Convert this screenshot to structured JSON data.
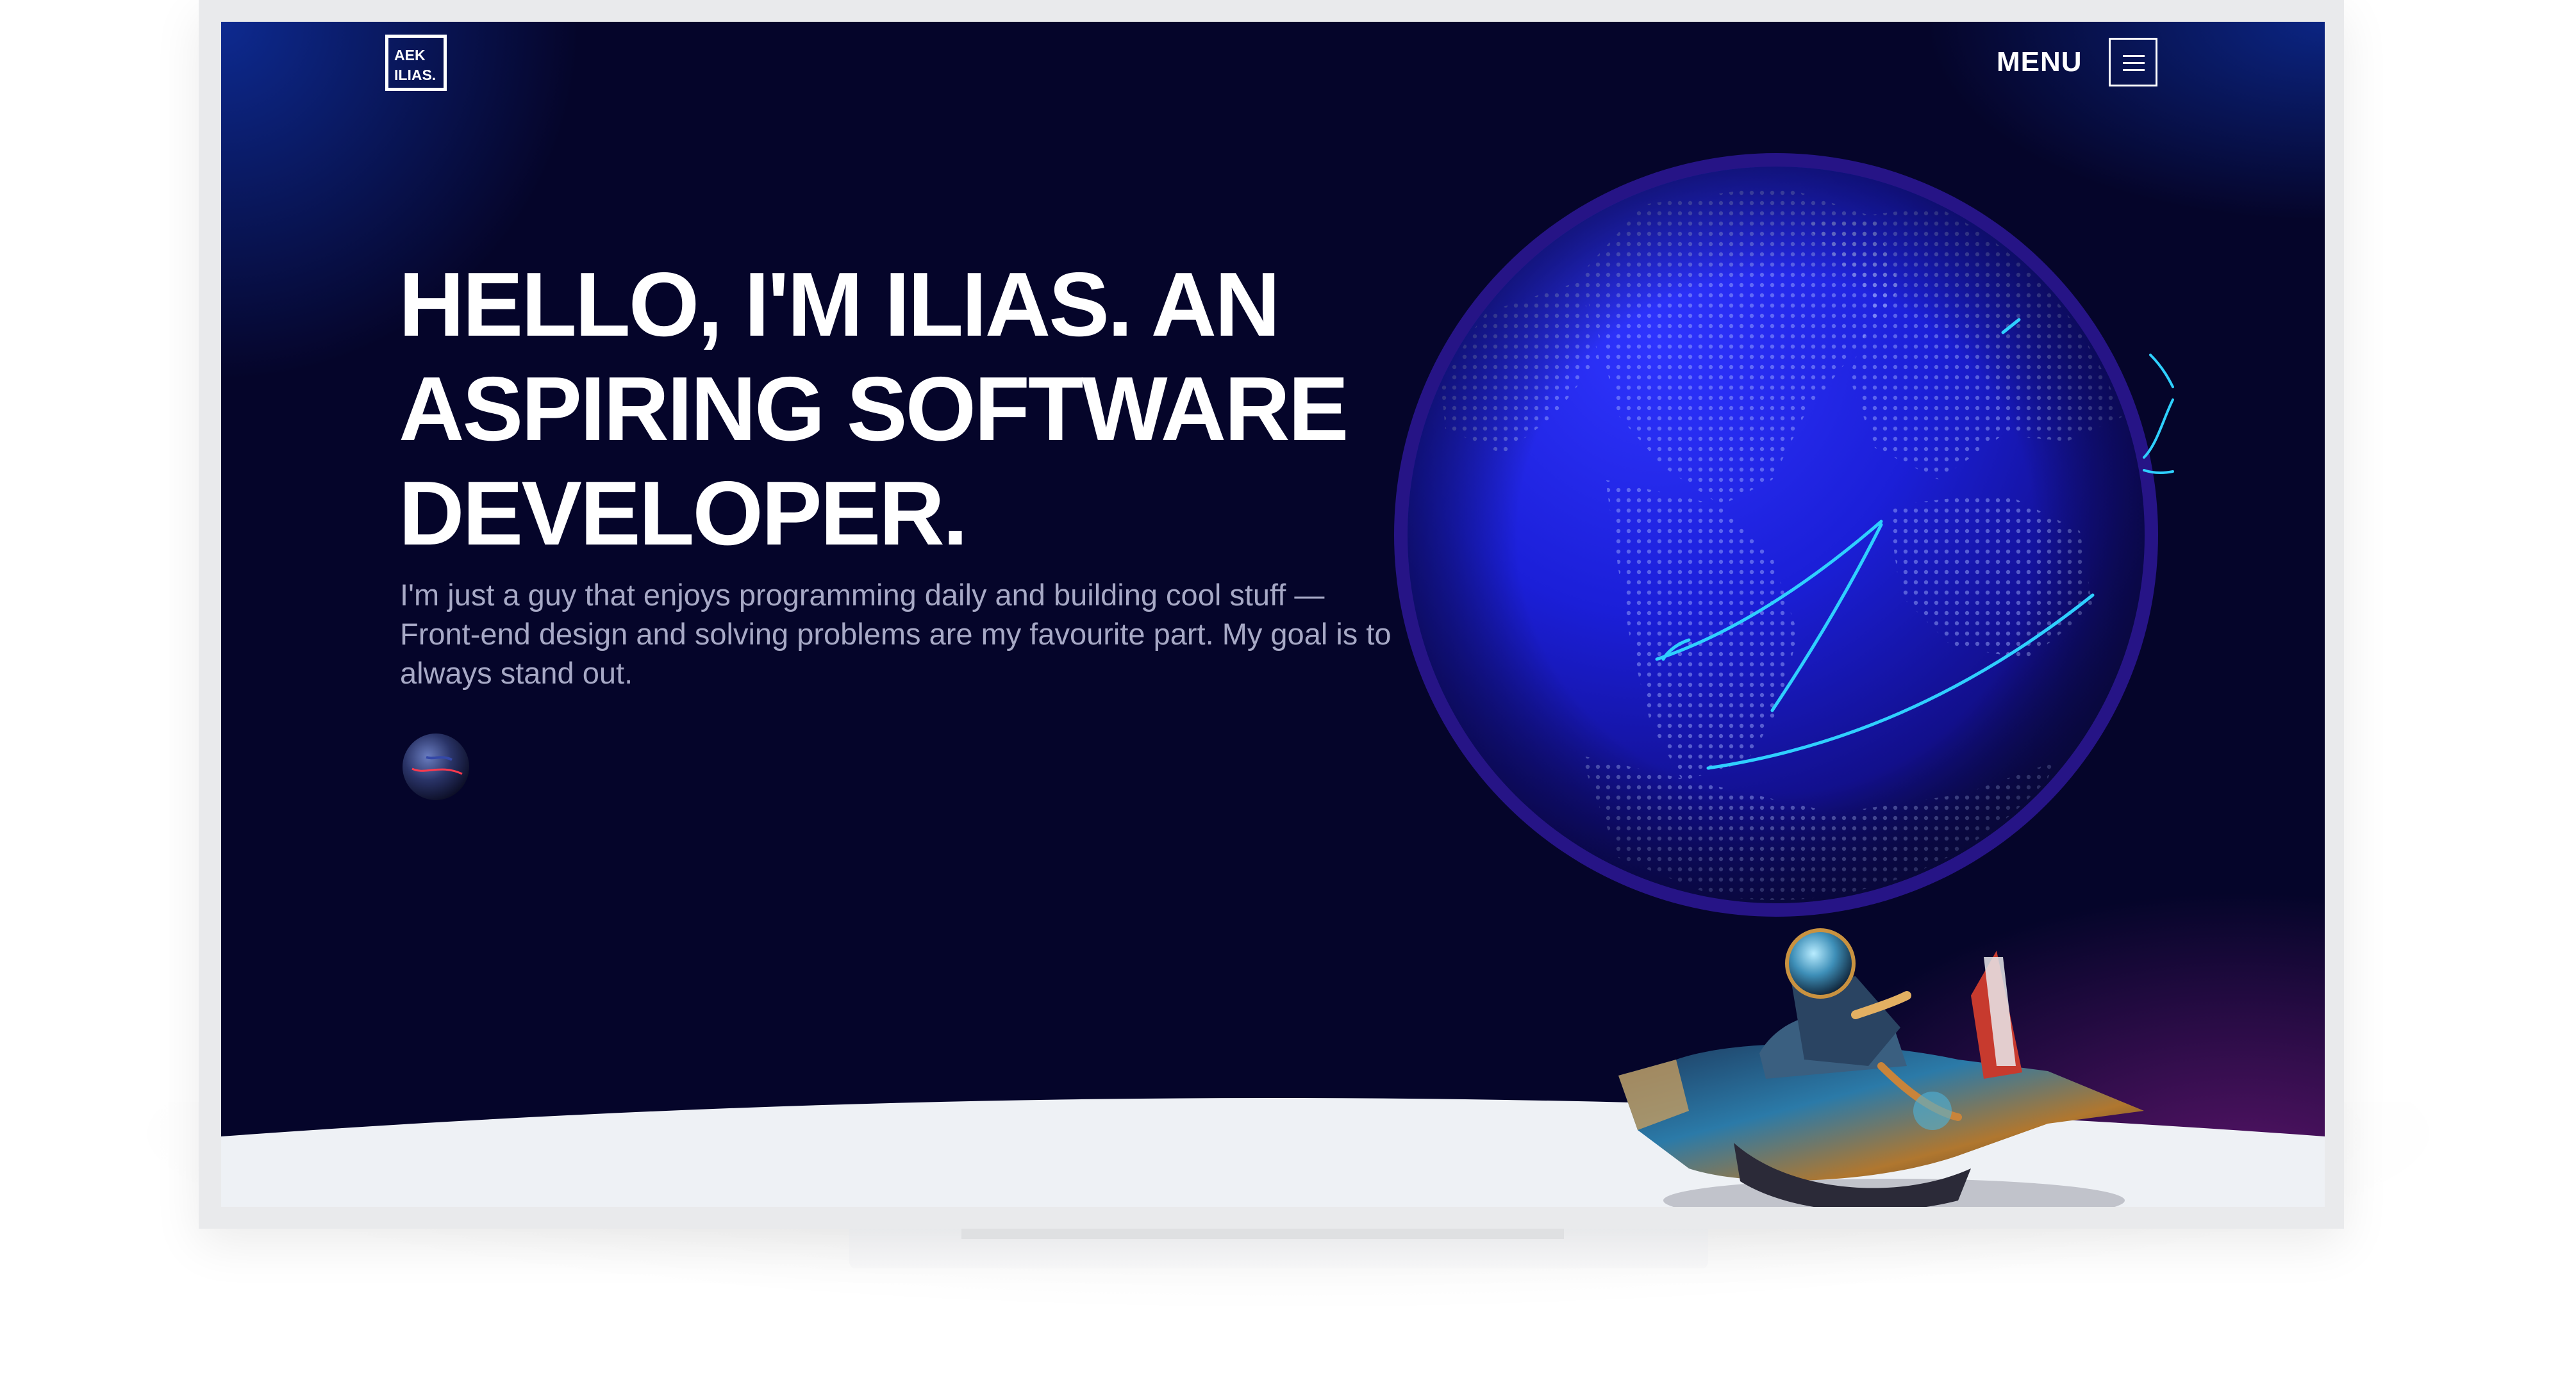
{
  "header": {
    "logo_line1": "AEK",
    "logo_line2": "ILIAS.",
    "menu_label": "MENU"
  },
  "hero": {
    "title_line1": "HELLO, I'M ILIAS. AN",
    "title_line2": "ASPIRING SOFTWARE",
    "title_line3": "DEVELOPER.",
    "paragraph_line1": "I'm just a guy that enjoys programming daily and building cool stuff —",
    "paragraph_line2": "Front-end design and solving problems are my favourite part. My goal is to",
    "paragraph_line3": "always stand out."
  },
  "icons": {
    "menu": "hamburger-icon",
    "planet": "planet-icon",
    "globe": "globe-illustration",
    "rocket": "astronaut-rocket-illustration"
  },
  "colors": {
    "background": "#05052a",
    "accent_blue": "#1f22e0",
    "accent_cyan": "#2fd0ff",
    "accent_purple": "#621670",
    "floor": "#eef1f5"
  }
}
